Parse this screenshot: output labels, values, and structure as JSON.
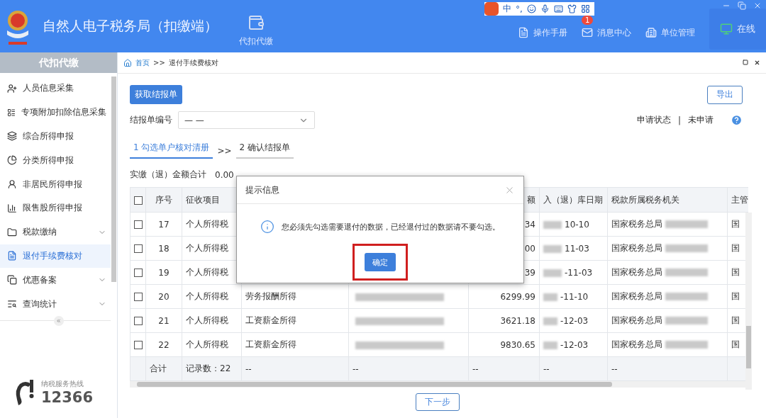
{
  "header": {
    "title": "自然人电子税务局（扣缴端）",
    "module": "代扣代缴",
    "nav": [
      {
        "label": "操作手册"
      },
      {
        "label": "消息中心",
        "badge": "1"
      },
      {
        "label": "单位管理"
      }
    ],
    "status": "在线"
  },
  "ime_bar": {
    "mode": "中",
    "punct": "°,"
  },
  "sidebar": {
    "title": "代扣代缴",
    "items": [
      {
        "label": "人员信息采集",
        "selected": false,
        "expandable": false
      },
      {
        "label": "专项附加扣除信息采集",
        "selected": false,
        "expandable": false
      },
      {
        "label": "综合所得申报",
        "selected": false,
        "expandable": false
      },
      {
        "label": "分类所得申报",
        "selected": false,
        "expandable": false
      },
      {
        "label": "非居民所得申报",
        "selected": false,
        "expandable": false
      },
      {
        "label": "限售股所得申报",
        "selected": false,
        "expandable": false
      },
      {
        "label": "税款缴纳",
        "selected": false,
        "expandable": true
      },
      {
        "label": "退付手续费核对",
        "selected": true,
        "expandable": false
      },
      {
        "label": "优惠备案",
        "selected": false,
        "expandable": true
      },
      {
        "label": "查询统计",
        "selected": false,
        "expandable": true
      }
    ],
    "collapse": "«",
    "hotline_label": "纳税服务热线",
    "hotline": "12366"
  },
  "breadcrumb": {
    "home": "首页",
    "sep": ">>",
    "current": "退付手续费核对"
  },
  "get_button": "获取结报单",
  "export_button": "导出",
  "report_no": {
    "label": "结报单编号",
    "value": "— —"
  },
  "apply_status": {
    "label": "申请状态",
    "sep": "|",
    "value": "未申请"
  },
  "steps": [
    {
      "label": "1 勾选单户核对清册",
      "selected": true
    },
    {
      "label": "2 确认结报单",
      "selected": false
    }
  ],
  "steps_sep": ">>",
  "total": {
    "label": "实缴（退）金额合计",
    "value": "0.00"
  },
  "table": {
    "header_checked": false,
    "columns": [
      "序号",
      "征收项目",
      "",
      "",
      "额",
      "入（退）库日期",
      "税款所属税务机关",
      "主管"
    ],
    "rows": [
      {
        "no": "17",
        "checked": false,
        "levy": "个人所得税",
        "amount": "34",
        "date": "10-10",
        "authority": "国家税务总局",
        "last": "国"
      },
      {
        "no": "18",
        "checked": false,
        "levy": "个人所得税",
        "amount": "00",
        "date": "11-03",
        "authority": "国家税务总局",
        "last": "国"
      },
      {
        "no": "19",
        "checked": false,
        "levy": "个人所得税",
        "amount": "39",
        "date": "-11-03",
        "authority": "国家税务总局",
        "last": "国"
      },
      {
        "no": "20",
        "checked": false,
        "levy": "个人所得税",
        "item": "劳务报酬所得",
        "amount": "6299.99",
        "date": "-11-10",
        "authority": "国家税务总局",
        "last": "国"
      },
      {
        "no": "21",
        "checked": false,
        "levy": "个人所得税",
        "item": "工资薪金所得",
        "amount": "3621.18",
        "date": "-12-03",
        "authority": "国家税务总局",
        "last": "国"
      },
      {
        "no": "22",
        "checked": false,
        "levy": "个人所得税",
        "item": "工资薪金所得",
        "amount": "9830.65",
        "date": "-12-03",
        "authority": "国家税务总局",
        "last": "国"
      }
    ],
    "footer": [
      "合计",
      "记录数：22",
      "--",
      "--",
      "--",
      "--",
      "--"
    ]
  },
  "next_button": "下一步",
  "dialog": {
    "title": "提示信息",
    "message": "您必须先勾选需要退付的数据，已经退付过的数据请不要勾选。",
    "confirm": {
      "label": "确定",
      "highlighted": true
    }
  }
}
